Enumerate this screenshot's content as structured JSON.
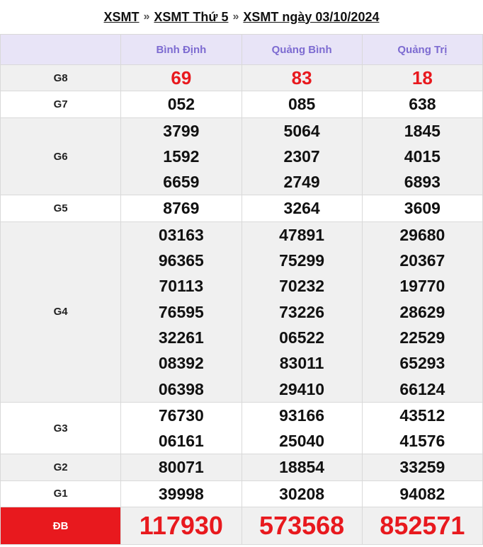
{
  "breadcrumb": {
    "link1": "XSMT",
    "sep": "»",
    "link2": "XSMT Thứ 5",
    "link3": "XSMT ngày 03/10/2024"
  },
  "provinces": [
    "Bình Định",
    "Quảng Bình",
    "Quảng Trị"
  ],
  "prizes": [
    {
      "label": "G8",
      "values": [
        [
          "69"
        ],
        [
          "83"
        ],
        [
          "18"
        ]
      ]
    },
    {
      "label": "G7",
      "values": [
        [
          "052"
        ],
        [
          "085"
        ],
        [
          "638"
        ]
      ]
    },
    {
      "label": "G6",
      "values": [
        [
          "3799",
          "1592",
          "6659"
        ],
        [
          "5064",
          "2307",
          "2749"
        ],
        [
          "1845",
          "4015",
          "6893"
        ]
      ]
    },
    {
      "label": "G5",
      "values": [
        [
          "8769"
        ],
        [
          "3264"
        ],
        [
          "3609"
        ]
      ]
    },
    {
      "label": "G4",
      "values": [
        [
          "03163",
          "96365",
          "70113",
          "76595",
          "32261",
          "08392",
          "06398"
        ],
        [
          "47891",
          "75299",
          "70232",
          "73226",
          "06522",
          "83011",
          "29410"
        ],
        [
          "29680",
          "20367",
          "19770",
          "28629",
          "22529",
          "65293",
          "66124"
        ]
      ]
    },
    {
      "label": "G3",
      "values": [
        [
          "76730",
          "06161"
        ],
        [
          "93166",
          "25040"
        ],
        [
          "43512",
          "41576"
        ]
      ]
    },
    {
      "label": "G2",
      "values": [
        [
          "80071"
        ],
        [
          "18854"
        ],
        [
          "33259"
        ]
      ]
    },
    {
      "label": "G1",
      "values": [
        [
          "39998"
        ],
        [
          "30208"
        ],
        [
          "94082"
        ]
      ]
    },
    {
      "label": "ĐB",
      "values": [
        [
          "117930"
        ],
        [
          "573568"
        ],
        [
          "852571"
        ]
      ]
    }
  ],
  "colors": {
    "header_bg": "#e8e4f7",
    "header_text": "#7d6bd1",
    "highlight": "#e8191e",
    "row_shade": "#f0f0f0"
  }
}
